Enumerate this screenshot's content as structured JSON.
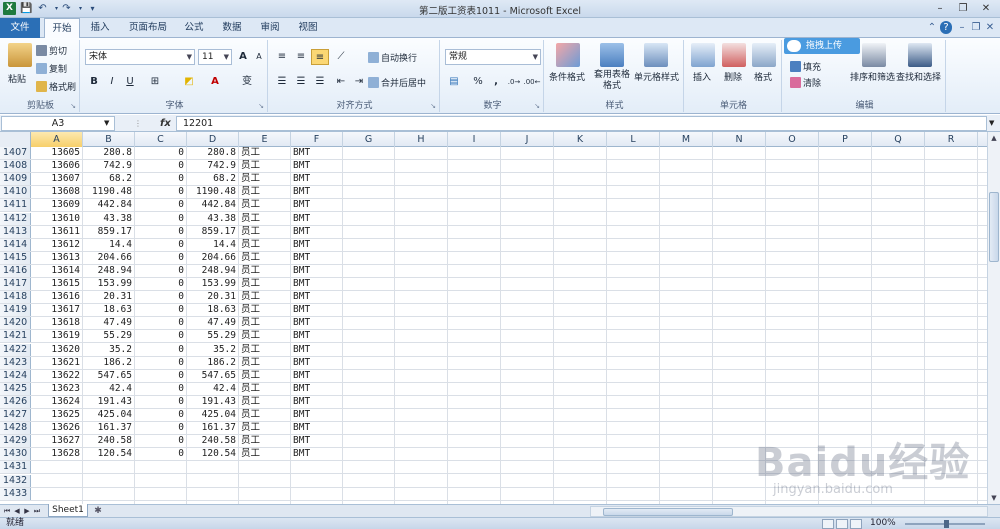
{
  "window": {
    "title": "第二版工资表1011 - Microsoft Excel",
    "app_icon": "X"
  },
  "ribbon_tabs": [
    "文件",
    "开始",
    "插入",
    "页面布局",
    "公式",
    "数据",
    "审阅",
    "视图"
  ],
  "ribbon": {
    "clipboard": {
      "label": "剪贴板",
      "paste": "粘贴",
      "cut": "剪切",
      "copy": "复制",
      "format_painter": "格式刷"
    },
    "font": {
      "label": "字体",
      "font_name": "宋体",
      "font_size": "11",
      "bold": "B",
      "italic": "I",
      "underline": "U",
      "grow": "A",
      "shrink": "A",
      "font_color": "A",
      "phonetic": "变"
    },
    "alignment": {
      "label": "对齐方式",
      "wrap": "自动换行",
      "merge": "合并后居中"
    },
    "number": {
      "label": "数字",
      "format": "常规",
      "percent": "%",
      "comma": ","
    },
    "styles": {
      "label": "样式",
      "conditional": "条件格式",
      "table": "套用表格格式",
      "cell_styles": "单元格样式"
    },
    "cells": {
      "label": "单元格",
      "insert": "插入",
      "delete": "删除",
      "format": "格式"
    },
    "editing": {
      "label": "编辑",
      "fill": "填充",
      "clear": "清除",
      "sort": "排序和筛选",
      "find": "查找和选择",
      "baidu_upload": "拖拽上传"
    }
  },
  "formula_bar": {
    "name_box": "A3",
    "fx": "fx",
    "value": "12201"
  },
  "columns": [
    "A",
    "B",
    "C",
    "D",
    "E",
    "F",
    "G",
    "H",
    "I",
    "J",
    "K",
    "L",
    "M",
    "N",
    "O",
    "P",
    "Q",
    "R"
  ],
  "rows": [
    {
      "n": "1407",
      "a": "13605",
      "b": "280.8",
      "c": "0",
      "d": "280.8",
      "e": "员工",
      "f": "BMT"
    },
    {
      "n": "1408",
      "a": "13606",
      "b": "742.9",
      "c": "0",
      "d": "742.9",
      "e": "员工",
      "f": "BMT"
    },
    {
      "n": "1409",
      "a": "13607",
      "b": "68.2",
      "c": "0",
      "d": "68.2",
      "e": "员工",
      "f": "BMT"
    },
    {
      "n": "1410",
      "a": "13608",
      "b": "1190.48",
      "c": "0",
      "d": "1190.48",
      "e": "员工",
      "f": "BMT"
    },
    {
      "n": "1411",
      "a": "13609",
      "b": "442.84",
      "c": "0",
      "d": "442.84",
      "e": "员工",
      "f": "BMT"
    },
    {
      "n": "1412",
      "a": "13610",
      "b": "43.38",
      "c": "0",
      "d": "43.38",
      "e": "员工",
      "f": "BMT"
    },
    {
      "n": "1413",
      "a": "13611",
      "b": "859.17",
      "c": "0",
      "d": "859.17",
      "e": "员工",
      "f": "BMT"
    },
    {
      "n": "1414",
      "a": "13612",
      "b": "14.4",
      "c": "0",
      "d": "14.4",
      "e": "员工",
      "f": "BMT"
    },
    {
      "n": "1415",
      "a": "13613",
      "b": "204.66",
      "c": "0",
      "d": "204.66",
      "e": "员工",
      "f": "BMT"
    },
    {
      "n": "1416",
      "a": "13614",
      "b": "248.94",
      "c": "0",
      "d": "248.94",
      "e": "员工",
      "f": "BMT"
    },
    {
      "n": "1417",
      "a": "13615",
      "b": "153.99",
      "c": "0",
      "d": "153.99",
      "e": "员工",
      "f": "BMT"
    },
    {
      "n": "1418",
      "a": "13616",
      "b": "20.31",
      "c": "0",
      "d": "20.31",
      "e": "员工",
      "f": "BMT"
    },
    {
      "n": "1419",
      "a": "13617",
      "b": "18.63",
      "c": "0",
      "d": "18.63",
      "e": "员工",
      "f": "BMT"
    },
    {
      "n": "1420",
      "a": "13618",
      "b": "47.49",
      "c": "0",
      "d": "47.49",
      "e": "员工",
      "f": "BMT"
    },
    {
      "n": "1421",
      "a": "13619",
      "b": "55.29",
      "c": "0",
      "d": "55.29",
      "e": "员工",
      "f": "BMT"
    },
    {
      "n": "1422",
      "a": "13620",
      "b": "35.2",
      "c": "0",
      "d": "35.2",
      "e": "员工",
      "f": "BMT"
    },
    {
      "n": "1423",
      "a": "13621",
      "b": "186.2",
      "c": "0",
      "d": "186.2",
      "e": "员工",
      "f": "BMT"
    },
    {
      "n": "1424",
      "a": "13622",
      "b": "547.65",
      "c": "0",
      "d": "547.65",
      "e": "员工",
      "f": "BMT"
    },
    {
      "n": "1425",
      "a": "13623",
      "b": "42.4",
      "c": "0",
      "d": "42.4",
      "e": "员工",
      "f": "BMT"
    },
    {
      "n": "1426",
      "a": "13624",
      "b": "191.43",
      "c": "0",
      "d": "191.43",
      "e": "员工",
      "f": "BMT"
    },
    {
      "n": "1427",
      "a": "13625",
      "b": "425.04",
      "c": "0",
      "d": "425.04",
      "e": "员工",
      "f": "BMT"
    },
    {
      "n": "1428",
      "a": "13626",
      "b": "161.37",
      "c": "0",
      "d": "161.37",
      "e": "员工",
      "f": "BMT"
    },
    {
      "n": "1429",
      "a": "13627",
      "b": "240.58",
      "c": "0",
      "d": "240.58",
      "e": "员工",
      "f": "BMT"
    },
    {
      "n": "1430",
      "a": "13628",
      "b": "120.54",
      "c": "0",
      "d": "120.54",
      "e": "员工",
      "f": "BMT"
    },
    {
      "n": "1431",
      "a": "",
      "b": "",
      "c": "",
      "d": "",
      "e": "",
      "f": ""
    },
    {
      "n": "1432",
      "a": "",
      "b": "",
      "c": "",
      "d": "",
      "e": "",
      "f": ""
    },
    {
      "n": "1433",
      "a": "",
      "b": "",
      "c": "",
      "d": "",
      "e": "",
      "f": ""
    }
  ],
  "sheet_tabs": [
    "Sheet1"
  ],
  "status": {
    "ready": "就绪",
    "zoom": "100%"
  },
  "watermark": {
    "line1": "Baidu经验",
    "line2": "jingyan.baidu.com"
  },
  "colors": {
    "file_tab": "#2b6fb6",
    "excel_green": "#1f7a3f",
    "selected_header": "#f7cf6a"
  }
}
